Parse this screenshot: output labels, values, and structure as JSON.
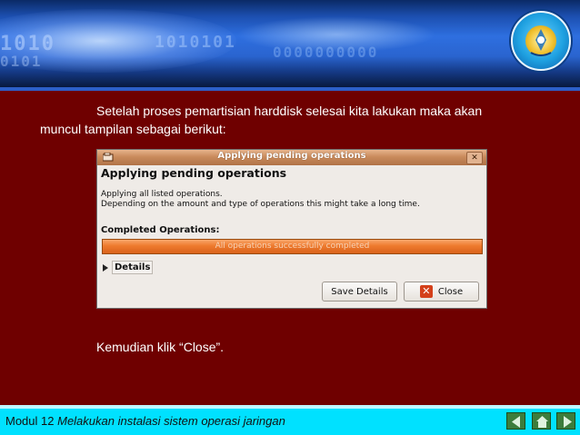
{
  "slide": {
    "paragraph_line1": "Setelah proses pemartisian harddisk selesai kita lakukan maka akan",
    "paragraph_line2": "muncul tampilan sebagai berikut:",
    "instruction": "Kemudian klik “Close”."
  },
  "header": {
    "binary_lines": [
      "1010",
      "0101",
      "1010101",
      "0000000000"
    ],
    "logo_icon": "tut-wuri-handayani-logo"
  },
  "dialog": {
    "window_title": "Applying pending operations",
    "heading": "Applying pending operations",
    "description_line1": "Applying all listed operations.",
    "description_line2": "Depending on the amount and type of operations this might take a long time.",
    "completed_label": "Completed Operations:",
    "progress_text": "All operations successfully completed",
    "progress_fraction": 1.0,
    "details_label": "Details",
    "save_details_label": "Save Details",
    "close_label": "Close",
    "accent_color": "#ee7a2e"
  },
  "footer": {
    "module": "Modul 12",
    "title": "Melakukan instalasi sistem operasi jaringan",
    "nav": [
      "prev-arrow-icon",
      "home-icon",
      "next-arrow-icon"
    ],
    "color": "#00e1ff"
  }
}
